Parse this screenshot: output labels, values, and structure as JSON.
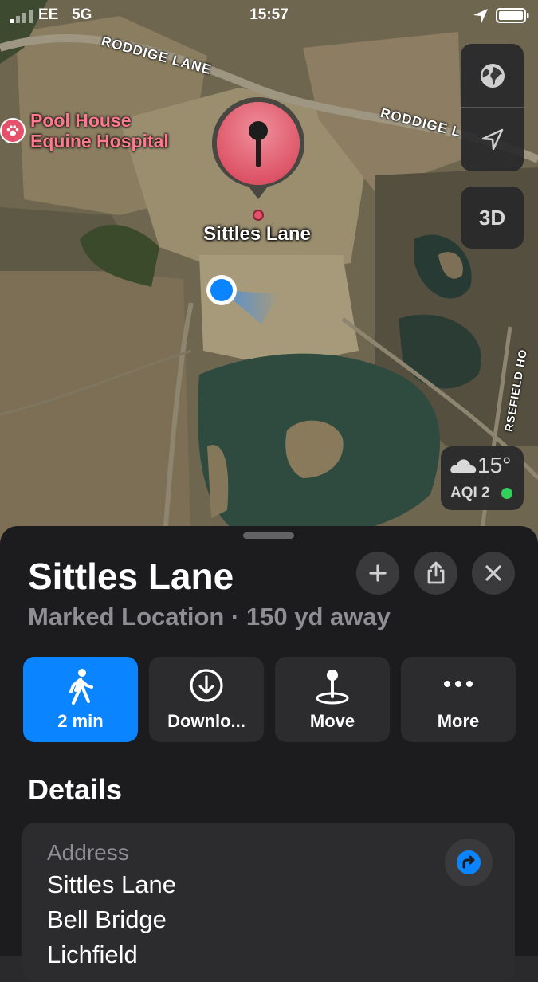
{
  "status": {
    "carrier": "EE",
    "network": "5G",
    "time": "15:57"
  },
  "map": {
    "roads": [
      "RODDIGE LANE",
      "RODDIGE L",
      "RSEFIELD HO"
    ],
    "poi": {
      "name_line1": "Pool House",
      "name_line2": "Equine Hospital",
      "icon": "paw-icon"
    },
    "pin_label": "Sittles Lane",
    "controls": {
      "three_d": "3D"
    },
    "weather": {
      "temp": "15°",
      "aqi": "AQI 2",
      "aqi_color": "#30d158"
    }
  },
  "sheet": {
    "title": "Sittles Lane",
    "subtitle": "Marked Location · 150 yd away",
    "actions": [
      {
        "label": "2 min",
        "icon": "walk-icon"
      },
      {
        "label": "Downlo...",
        "icon": "download-icon"
      },
      {
        "label": "Move",
        "icon": "move-pin-icon"
      },
      {
        "label": "More",
        "icon": "more-icon"
      }
    ],
    "details_heading": "Details",
    "address": {
      "label": "Address",
      "lines": [
        "Sittles Lane",
        "Bell Bridge",
        "Lichfield"
      ]
    }
  },
  "colors": {
    "accent": "#0a84ff",
    "pin": "#e5506b",
    "poi_text": "#ff7a8e"
  }
}
